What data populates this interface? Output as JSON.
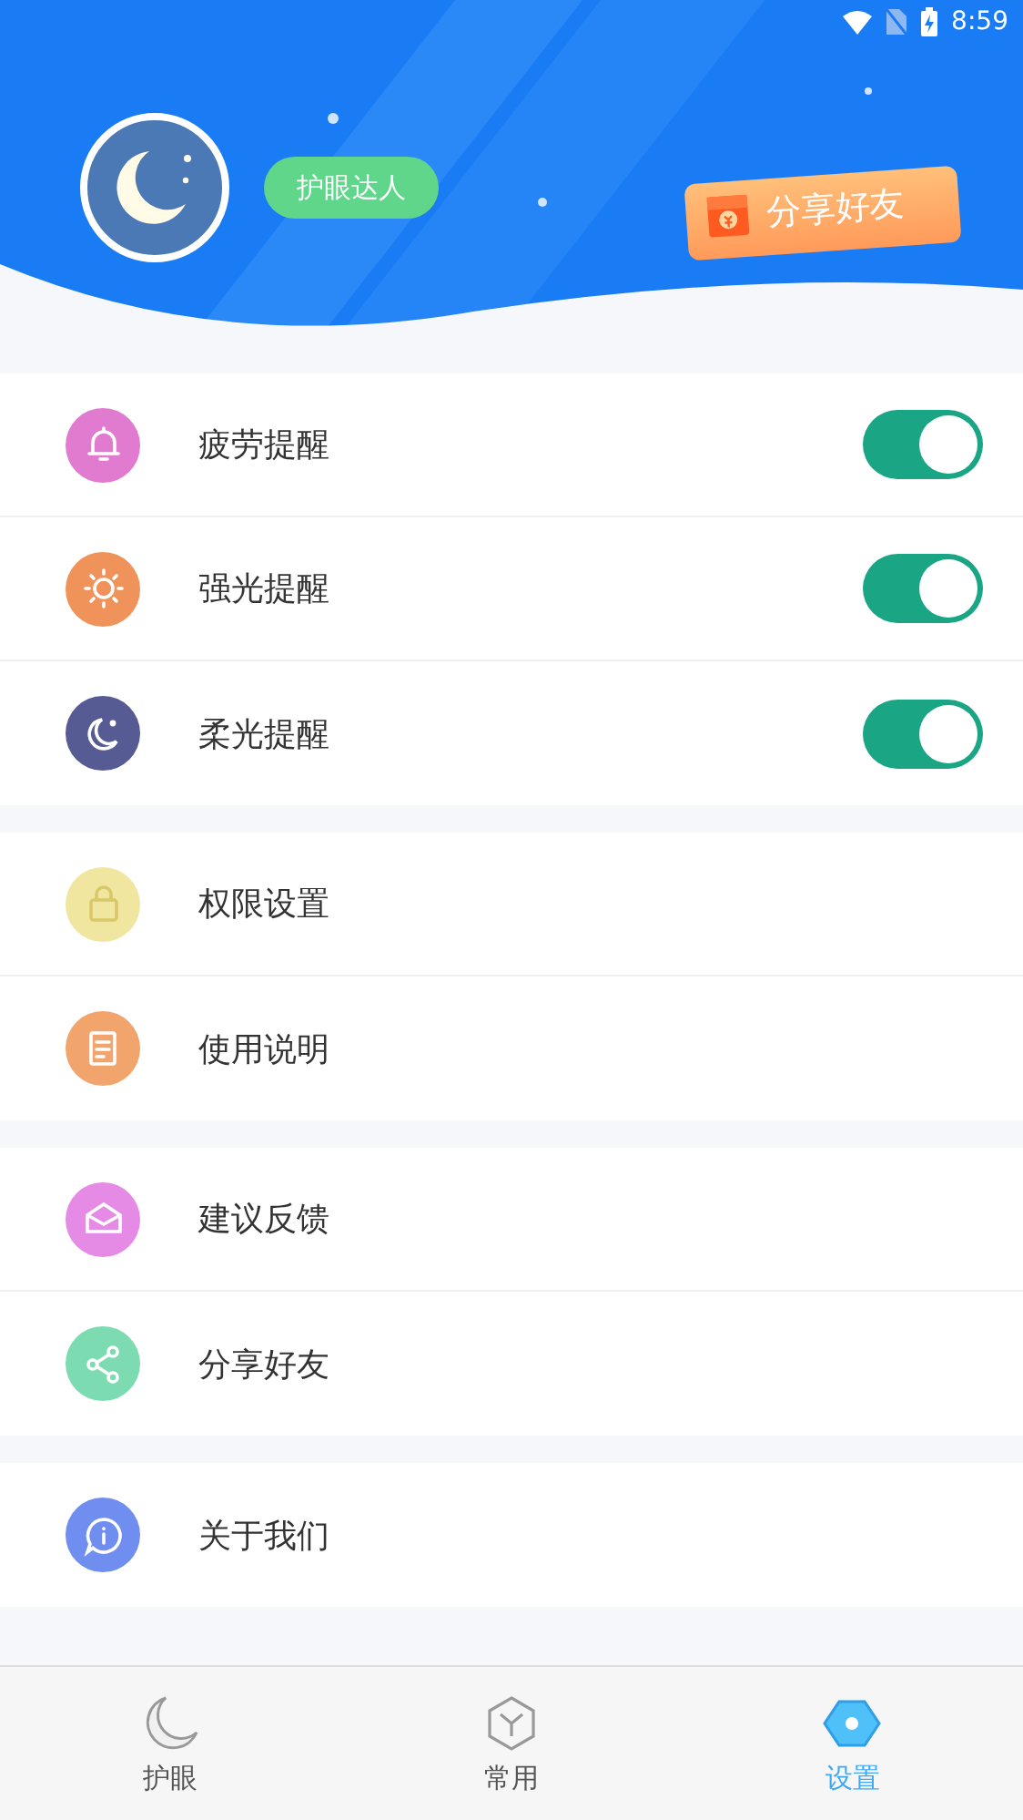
{
  "status_bar": {
    "time": "8:59"
  },
  "header": {
    "badge": "护眼达人",
    "share_button": "分享好友"
  },
  "groups": [
    {
      "items": [
        {
          "kind": "toggle",
          "label": "疲劳提醒",
          "color": "#e07bd0",
          "on": true
        },
        {
          "kind": "toggle",
          "label": "强光提醒",
          "color": "#f0935a",
          "on": true
        },
        {
          "kind": "toggle",
          "label": "柔光提醒",
          "color": "#575b93",
          "on": true
        }
      ]
    },
    {
      "items": [
        {
          "kind": "link",
          "label": "权限设置",
          "color": "#f0e6a0"
        },
        {
          "kind": "link",
          "label": "使用说明",
          "color": "#f1a46c"
        }
      ]
    },
    {
      "items": [
        {
          "kind": "link",
          "label": "建议反馈",
          "color": "#e58be6"
        },
        {
          "kind": "link",
          "label": "分享好友",
          "color": "#7ddbb1"
        }
      ]
    },
    {
      "items": [
        {
          "kind": "link",
          "label": "关于我们",
          "color": "#6f8ef0"
        }
      ]
    }
  ],
  "tabs": [
    {
      "label": "护眼",
      "selected": false
    },
    {
      "label": "常用",
      "selected": false
    },
    {
      "label": "设置",
      "selected": true
    }
  ]
}
